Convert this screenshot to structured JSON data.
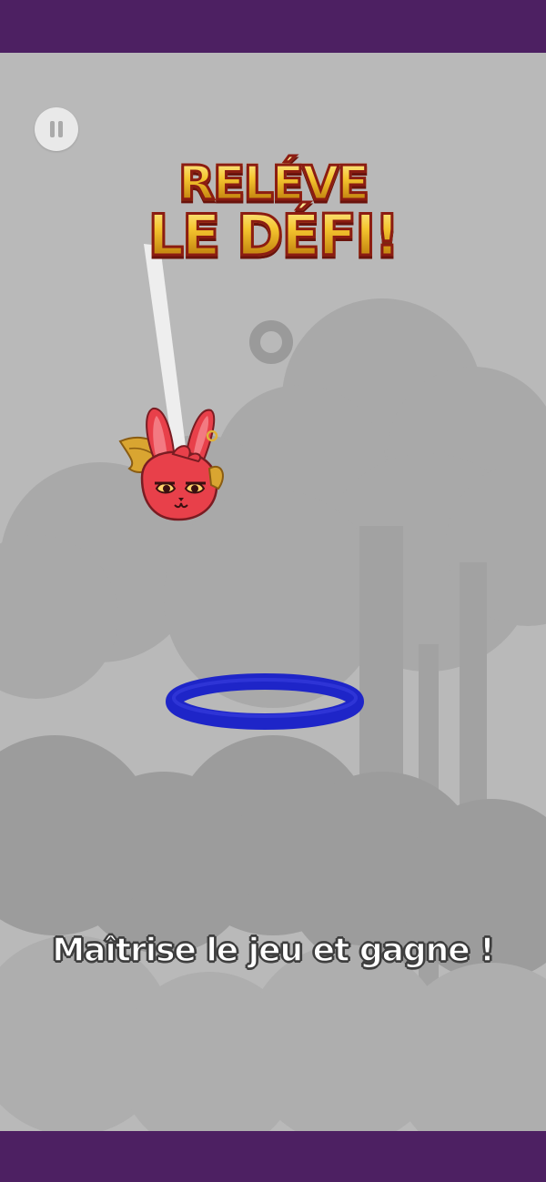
{
  "game": {
    "title_line_1": "RELÉVE",
    "title_line_2": "LE DÉFI!",
    "tagline": "Maîtrise le jeu et gagne !",
    "colors": {
      "frame": "#4d2062",
      "background": "#b9b9b9",
      "ring": "#1e25c8",
      "character": "#e8404a",
      "title_fill": "#f5c52f",
      "title_outline": "#8b1c12"
    },
    "icons": {
      "pause": "pause-icon",
      "character": "winged-bunny-icon",
      "target": "blue-ring",
      "small_ring": "small-ring"
    }
  }
}
